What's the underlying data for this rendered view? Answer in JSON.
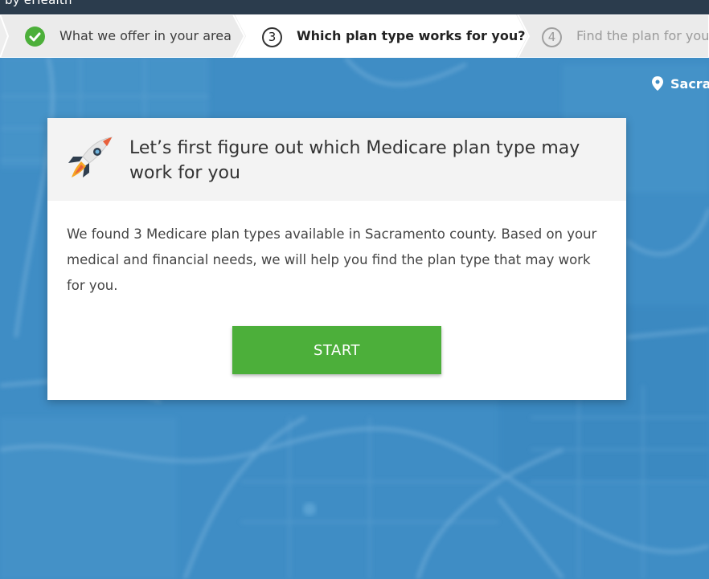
{
  "header": {
    "brand": "by eHealth"
  },
  "steps": [
    {
      "label": "What we offer in your area",
      "status": "completed",
      "icon": "check-icon"
    },
    {
      "number": "3",
      "label": "Which plan type works for you?",
      "status": "active"
    },
    {
      "number": "4",
      "label": "Find the plan for you",
      "status": "upcoming"
    }
  ],
  "location": {
    "text": "Sacra",
    "icon": "map-pin-icon"
  },
  "card": {
    "title": "Let’s first figure out which Medicare plan type may work for you",
    "icon": "rocket-icon",
    "body": "We found 3 Medicare plan types available in Sacramento county. Based on your medical and financial needs, we will help you find the plan type that may work for you.",
    "start_label": "START"
  },
  "colors": {
    "accent_green": "#4caf3a",
    "map_blue": "#3d8cc4",
    "header_dark": "#2b3c4d"
  }
}
